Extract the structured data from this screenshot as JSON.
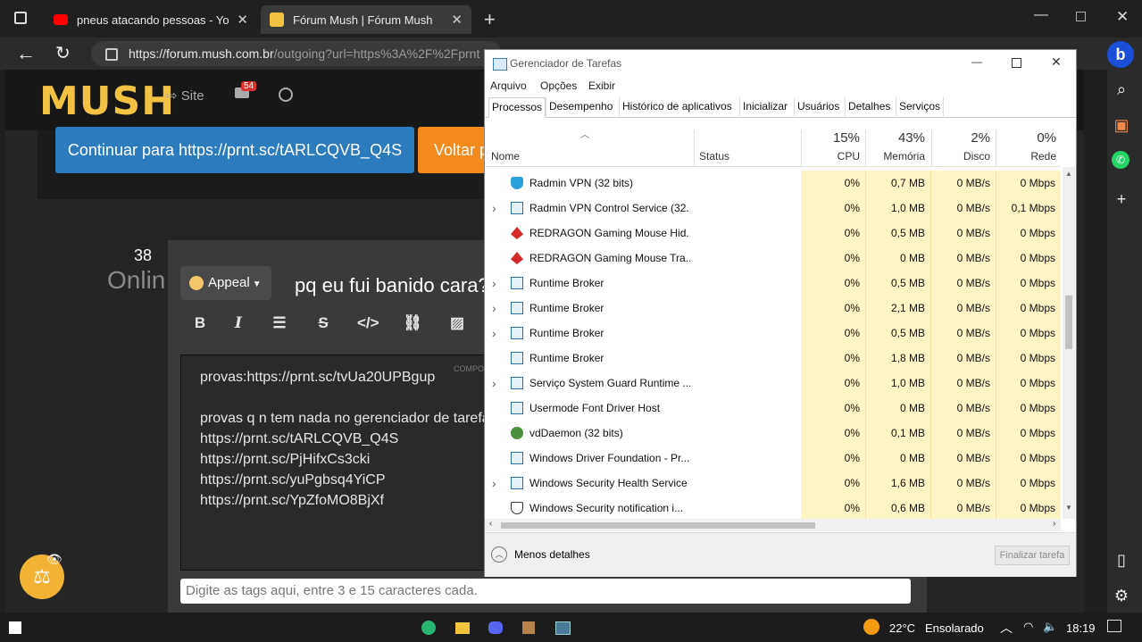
{
  "browser": {
    "tabs": [
      {
        "title": "pneus atacando pessoas - YouTube",
        "icon": "youtube-icon",
        "active": false
      },
      {
        "title": "Fórum Mush | Fórum Mush",
        "icon": "mush-favicon",
        "active": true
      }
    ],
    "url_host": "https://forum.mush.com.br",
    "url_path": "/outgoing?url=https%3A%2F%2Fprnt"
  },
  "forum": {
    "logo": "MUSH",
    "nav_site": "Site",
    "notif_count": "54",
    "continue_button": "Continuar para https://prnt.sc/tARLCQVB_Q4S",
    "back_button": "Voltar p",
    "online_count": "38",
    "online_label": "Onlin",
    "category_label": "Appeal",
    "post_title": "pq eu fui banido cara?",
    "compose_tag": "COMPO",
    "editor_lines": [
      "provas:https://prnt.sc/tvUa20UPBgup",
      "",
      "provas q n tem nada no gerenciador de tarefa",
      "https://prnt.sc/tARLCQVB_Q4S",
      "https://prnt.sc/PjHifxCs3cki",
      "https://prnt.sc/yuPgbsq4YiCP",
      "https://prnt.sc/YpZfoMO8BjXf"
    ],
    "tags_placeholder": "Digite as tags aqui, entre 3 e 15 caracteres cada."
  },
  "taskmgr": {
    "title": "Gerenciador de Tarefas",
    "menu": [
      "Arquivo",
      "Opções",
      "Exibir"
    ],
    "tabs": [
      "Processos",
      "Desempenho",
      "Histórico de aplicativos",
      "Inicializar",
      "Usuários",
      "Detalhes",
      "Serviços"
    ],
    "columns": {
      "name": "Nome",
      "status": "Status",
      "cpu_pct": "15%",
      "cpu": "CPU",
      "mem_pct": "43%",
      "mem": "Memória",
      "disk_pct": "2%",
      "disk": "Disco",
      "net_pct": "0%",
      "net": "Rede"
    },
    "rows": [
      {
        "name": "Radmin VPN (32 bits)",
        "expand": false,
        "icon": "radmin-shield-icon",
        "cpu": "0%",
        "mem": "0,7 MB",
        "disk": "0 MB/s",
        "net": "0 Mbps"
      },
      {
        "name": "Radmin VPN Control Service (32...",
        "expand": true,
        "icon": "service-window-icon",
        "cpu": "0%",
        "mem": "1,0 MB",
        "disk": "0 MB/s",
        "net": "0,1 Mbps"
      },
      {
        "name": "REDRAGON Gaming Mouse Hid...",
        "expand": false,
        "icon": "redragon-icon",
        "cpu": "0%",
        "mem": "0,5 MB",
        "disk": "0 MB/s",
        "net": "0 Mbps"
      },
      {
        "name": "REDRAGON Gaming Mouse Tra...",
        "expand": false,
        "icon": "redragon-icon",
        "cpu": "0%",
        "mem": "0 MB",
        "disk": "0 MB/s",
        "net": "0 Mbps"
      },
      {
        "name": "Runtime Broker",
        "expand": true,
        "icon": "service-window-icon",
        "cpu": "0%",
        "mem": "0,5 MB",
        "disk": "0 MB/s",
        "net": "0 Mbps"
      },
      {
        "name": "Runtime Broker",
        "expand": true,
        "icon": "service-window-icon",
        "cpu": "0%",
        "mem": "2,1 MB",
        "disk": "0 MB/s",
        "net": "0 Mbps"
      },
      {
        "name": "Runtime Broker",
        "expand": true,
        "icon": "service-window-icon",
        "cpu": "0%",
        "mem": "0,5 MB",
        "disk": "0 MB/s",
        "net": "0 Mbps"
      },
      {
        "name": "Runtime Broker",
        "expand": false,
        "icon": "service-window-icon",
        "cpu": "0%",
        "mem": "1,8 MB",
        "disk": "0 MB/s",
        "net": "0 Mbps"
      },
      {
        "name": "Serviço System Guard Runtime ...",
        "expand": true,
        "icon": "service-window-icon",
        "cpu": "0%",
        "mem": "1,0 MB",
        "disk": "0 MB/s",
        "net": "0 Mbps"
      },
      {
        "name": "Usermode Font Driver Host",
        "expand": false,
        "icon": "service-window-icon",
        "cpu": "0%",
        "mem": "0 MB",
        "disk": "0 MB/s",
        "net": "0 Mbps"
      },
      {
        "name": "vdDaemon (32 bits)",
        "expand": false,
        "icon": "vd-daemon-icon",
        "cpu": "0%",
        "mem": "0,1 MB",
        "disk": "0 MB/s",
        "net": "0 Mbps"
      },
      {
        "name": "Windows Driver Foundation - Pr...",
        "expand": false,
        "icon": "service-window-icon",
        "cpu": "0%",
        "mem": "0 MB",
        "disk": "0 MB/s",
        "net": "0 Mbps"
      },
      {
        "name": "Windows Security Health Service",
        "expand": true,
        "icon": "service-window-icon",
        "cpu": "0%",
        "mem": "1,6 MB",
        "disk": "0 MB/s",
        "net": "0 Mbps"
      },
      {
        "name": "Windows Security notification i...",
        "expand": false,
        "icon": "security-shield-icon",
        "cpu": "0%",
        "mem": "0,6 MB",
        "disk": "0 MB/s",
        "net": "0 Mbps"
      }
    ],
    "less_details": "Menos detalhes",
    "end_task": "Finalizar tarefa"
  },
  "taskbar": {
    "temperature": "22°C",
    "weather": "Ensolarado",
    "time": "18:19"
  },
  "colors": {
    "mush_yellow": "#f4c243",
    "continue_blue": "#2b7bbd",
    "back_orange": "#f28a1c",
    "tm_cell_yellow": "#fff4c4"
  }
}
